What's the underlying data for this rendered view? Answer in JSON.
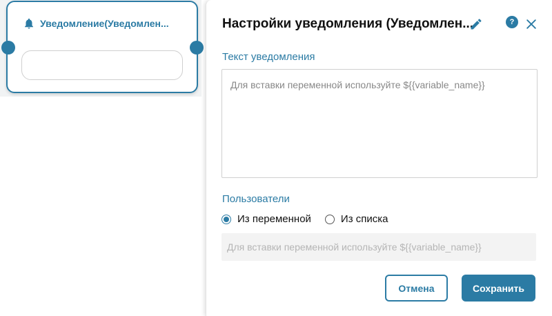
{
  "colors": {
    "accent": "#2b7ba4",
    "canvas_bg": "#f1f3f4",
    "input_disabled_bg": "#f3f3f3"
  },
  "node": {
    "icon": "bell-icon",
    "title": "Уведомление(Уведомлен..."
  },
  "panel": {
    "title": "Настройки уведомления (Уведомлен...",
    "edit_icon": "pencil-icon",
    "help_icon": "help-icon",
    "help_label": "?",
    "close_icon": "close-icon",
    "notification_text": {
      "label": "Текст уведомления",
      "value": "",
      "placeholder": "Для вставки переменной используйте ${{variable_name}}"
    },
    "users": {
      "label": "Пользователи",
      "options": [
        {
          "label": "Из переменной",
          "selected": true
        },
        {
          "label": "Из списка",
          "selected": false
        }
      ],
      "variable_input": {
        "value": "",
        "placeholder": "Для вставки переменной используйте ${{variable_name}}"
      }
    },
    "buttons": {
      "cancel": "Отмена",
      "save": "Сохранить"
    }
  }
}
